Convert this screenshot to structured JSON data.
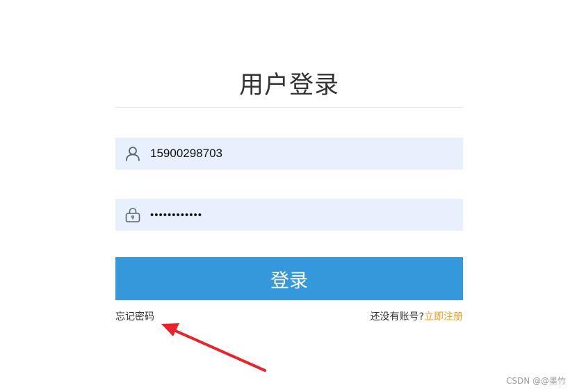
{
  "login": {
    "title": "用户登录",
    "username_value": "15900298703",
    "password_value": "............",
    "submit_label": "登录",
    "forgot_password_label": "忘记密码",
    "no_account_text": "还没有账号?",
    "register_label": "立即注册"
  },
  "watermark": "CSDN @@墨竹",
  "colors": {
    "accent_button": "#3498db",
    "input_background": "#e8f0fe",
    "register_link": "#f39c12",
    "annotation_arrow": "#e8232b"
  },
  "icons": {
    "username": "user-icon",
    "password": "lock-icon"
  }
}
